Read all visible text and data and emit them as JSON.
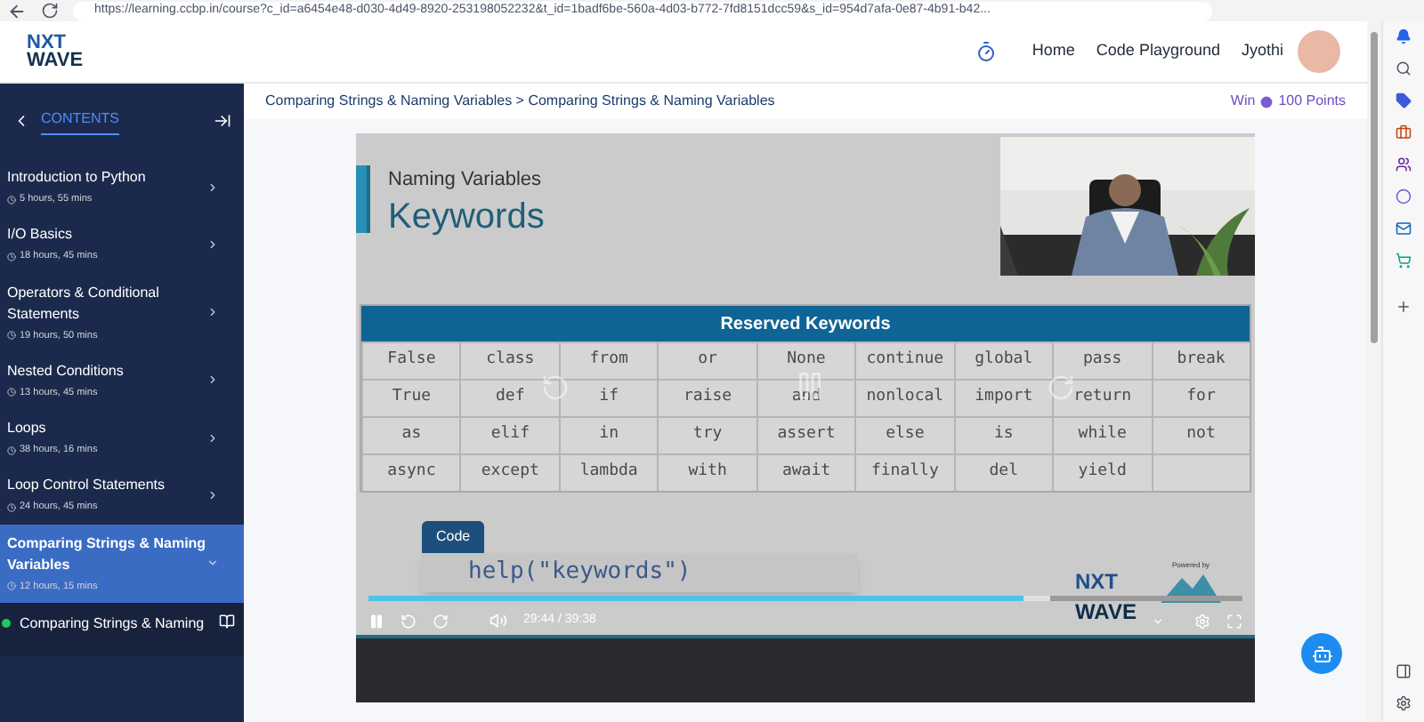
{
  "browser": {
    "url": "https://learning.ccbp.in/course?c_id=a6454e48-d030-4d49-8920-253198052232&t_id=1badf6be-560a-4d03-b772-7fd8151dcc59&s_id=954d7afa-0e87-4b91-b42..."
  },
  "header": {
    "logo": [
      "NXT",
      "WAVE"
    ],
    "nav": [
      {
        "label": "Home"
      },
      {
        "label": "Code Playground"
      }
    ],
    "user": "Jyothi"
  },
  "sidebar": {
    "title": "CONTENTS",
    "items": [
      {
        "title": "Introduction to Python",
        "duration": "5 hours, 55 mins",
        "selected": false
      },
      {
        "title": "I/O Basics",
        "duration": "18 hours, 45 mins",
        "selected": false
      },
      {
        "title": "Operators & Conditional Statements",
        "duration": "19 hours, 50 mins",
        "selected": false
      },
      {
        "title": "Nested Conditions",
        "duration": "13 hours, 45 mins",
        "selected": false
      },
      {
        "title": "Loops",
        "duration": "38 hours, 16 mins",
        "selected": false
      },
      {
        "title": "Loop Control Statements",
        "duration": "24 hours, 45 mins",
        "selected": false
      },
      {
        "title": "Comparing Strings & Naming Variables",
        "duration": "12 hours, 15 mins",
        "selected": true
      }
    ],
    "lesson": {
      "title": "Comparing Strings & Naming",
      "completed": true
    }
  },
  "breadcrumb": "Comparing Strings & Naming Variables > Comparing Strings & Naming Variables",
  "reward": {
    "prefix": "Win",
    "points": "100 Points"
  },
  "video": {
    "slide": {
      "subtitle": "Naming Variables",
      "title": "Keywords",
      "table": {
        "title": "Reserved Keywords",
        "rows": [
          [
            "False",
            "class",
            "from",
            "or",
            "None",
            "continue",
            "global",
            "pass",
            "break"
          ],
          [
            "True",
            "def",
            "if",
            "raise",
            "and",
            "nonlocal",
            "import",
            "return",
            "for"
          ],
          [
            "as",
            "elif",
            "in",
            "try",
            "assert",
            "else",
            "is",
            "while",
            "not"
          ],
          [
            "async",
            "except",
            "lambda",
            "with",
            "await",
            "finally",
            "del",
            "yield"
          ]
        ]
      },
      "code_label": "Code",
      "code": "help(\"keywords\")",
      "brand": [
        "NXT",
        "WAVE"
      ],
      "powered_by": "Powered by"
    },
    "player": {
      "playing": true,
      "level": 0.75,
      "time": "29:44 / 39:38"
    }
  }
}
